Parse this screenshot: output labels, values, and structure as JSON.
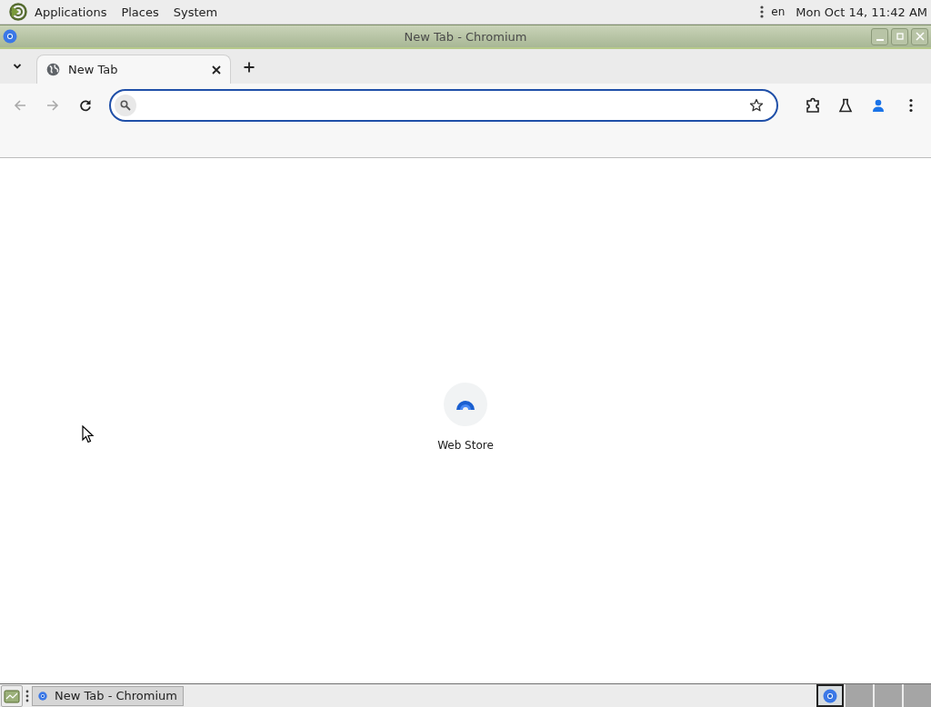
{
  "top_panel": {
    "menus": [
      "Applications",
      "Places",
      "System"
    ],
    "language": "en",
    "clock": "Mon Oct 14, 11:42 AM"
  },
  "window": {
    "title": "New Tab - Chromium"
  },
  "tabs": [
    {
      "label": "New Tab",
      "selected": true
    }
  ],
  "shortcuts": [
    {
      "label": "Web Store"
    }
  ],
  "taskbar": {
    "tasks": [
      {
        "label": "New Tab - Chromium",
        "selected": false
      }
    ],
    "workspaces": [
      {
        "selected": true
      },
      {
        "selected": false
      },
      {
        "selected": false
      },
      {
        "selected": false
      }
    ]
  }
}
